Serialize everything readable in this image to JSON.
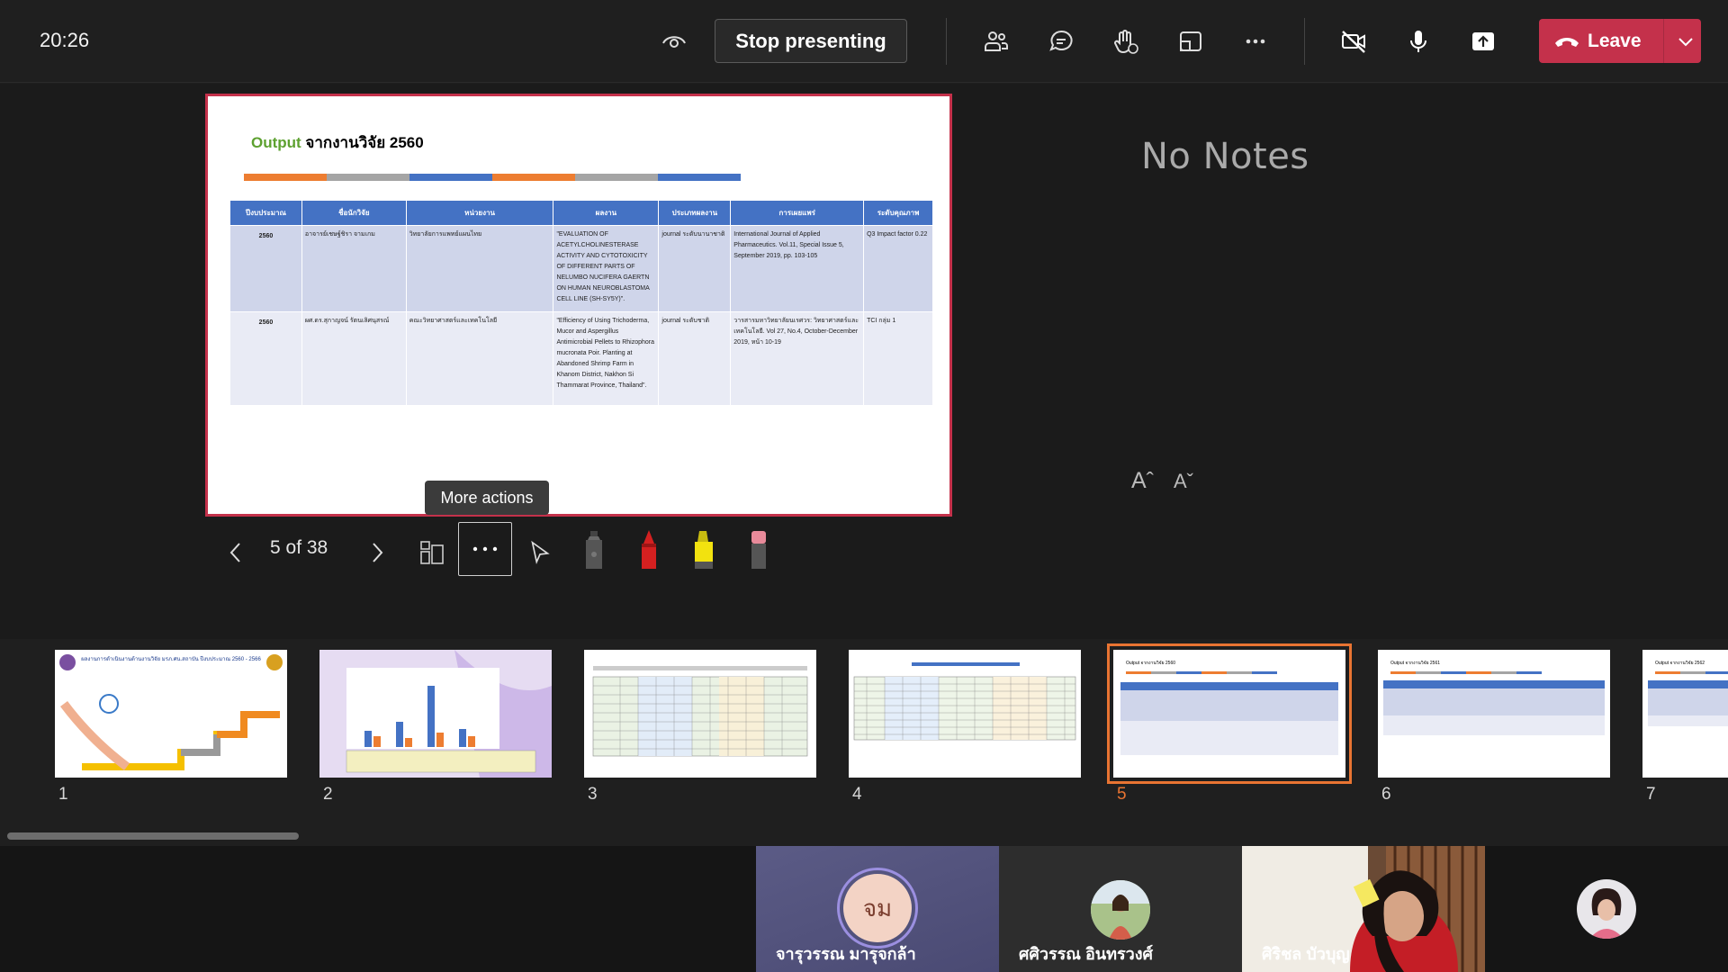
{
  "topbar": {
    "clock": "20:26",
    "stop_presenting": "Stop presenting",
    "leave": "Leave"
  },
  "slide": {
    "title_accent": "Output",
    "title_rest": " จากงานวิจัย   2560",
    "stripe_colors": [
      "#ed7d31",
      "#a5a5a5",
      "#4472c4",
      "#ed7d31",
      "#a5a5a5",
      "#4472c4"
    ],
    "headers": [
      "ปีงบประมาณ",
      "ชื่อนักวิจัย",
      "หน่วยงาน",
      "ผลงาน",
      "ประเภทผลงาน",
      "การเผยแพร่",
      "ระดับคุณภาพ"
    ],
    "rows": [
      {
        "year": "2560",
        "researcher": "อาจารย์เชษฐ์ชิรา จามเกม",
        "unit": "วิทยาลัยการแพทย์แผนไทย",
        "work": "\"EVALUATION OF ACETYLCHOLINESTERASE ACTIVITY AND CYTOTOXICITY OF DIFFERENT PARTS OF NELUMBO NUCIFERA GAERTN ON HUMAN NEUROBLASTOMA CELL LINE (SH-SY5Y)\".",
        "type": "journal ระดับนานาชาติ",
        "publication": "International Journal of Applied Pharmaceutics. Vol.11, Special Issue 5, September 2019, pp. 103-105",
        "quality": "Q3 Impact factor 0.22"
      },
      {
        "year": "2560",
        "researcher": "ผศ.ดร.สุกาญจน์ รัตนเลิศนุสรณ์",
        "unit": "คณะวิทยาศาสตร์และเทคโนโลยี",
        "work": "\"Efficiency of Using Trichoderma, Mucor and Aspergillus Antimicrobial Pellets to Rhizophora mucronata Poir. Planting at Abandoned Shrimp Farm in Khanom District, Nakhon Si Thammarat Province, Thailand\".",
        "type": "journal ระดับชาติ",
        "publication": "วารสารมหาวิทยาลัยนเรศวร: วิทยาศาสตร์และเทคโนโลยี. Vol 27, No.4, October-December 2019, หน้า 10-19",
        "quality": "TCI กลุ่ม 1"
      }
    ]
  },
  "notes": {
    "empty_text": "No Notes",
    "font_increase": "Aˆ",
    "font_decrease": "Aˇ"
  },
  "controls": {
    "page_indicator": "5 of 38",
    "tooltip": "More actions",
    "pen_colors": [
      "#555555",
      "#d42020",
      "#f2e20f",
      "#e88a9a"
    ]
  },
  "thumbnails": {
    "numbers": [
      "1",
      "2",
      "3",
      "4",
      "5",
      "6",
      "7"
    ],
    "selected_index": 5,
    "t1_title": "ผลงานการดำเนินงานด้านงานวิจัย มรภ.ศน.สถาบัน ปีงบประมาณ 2560 - 2566",
    "t5_title": "Output จากงานวิจัย 2560",
    "t6_title": "Output จากงานวิจัย 2561",
    "t7_title": "Output จากงานวิจัย 2562"
  },
  "participants": [
    {
      "name": "จารุวรรณ มารุจกล้า",
      "initials": "จม"
    },
    {
      "name": "ศศิวรรณ อินทรวงศ์"
    },
    {
      "name": "ศิริชล บัวบุญ"
    },
    {
      "name": ""
    }
  ]
}
